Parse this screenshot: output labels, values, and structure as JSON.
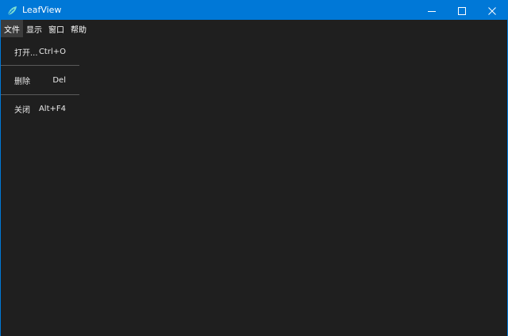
{
  "window": {
    "title": "LeafView",
    "accent_color": "#0078d7",
    "background_color": "#1f1f1f",
    "controls": {
      "minimize_icon": "minimize-icon",
      "maximize_icon": "maximize-icon",
      "close_icon": "close-icon"
    }
  },
  "menubar": {
    "items": [
      {
        "label": "文件",
        "active": true
      },
      {
        "label": "显示",
        "active": false
      },
      {
        "label": "窗口",
        "active": false
      },
      {
        "label": "帮助",
        "active": false
      }
    ]
  },
  "file_menu": {
    "items": [
      {
        "label": "打开...",
        "shortcut": "Ctrl+O"
      },
      {
        "label": "删除",
        "shortcut": "Del"
      },
      {
        "label": "关闭",
        "shortcut": "Alt+F4"
      }
    ]
  }
}
